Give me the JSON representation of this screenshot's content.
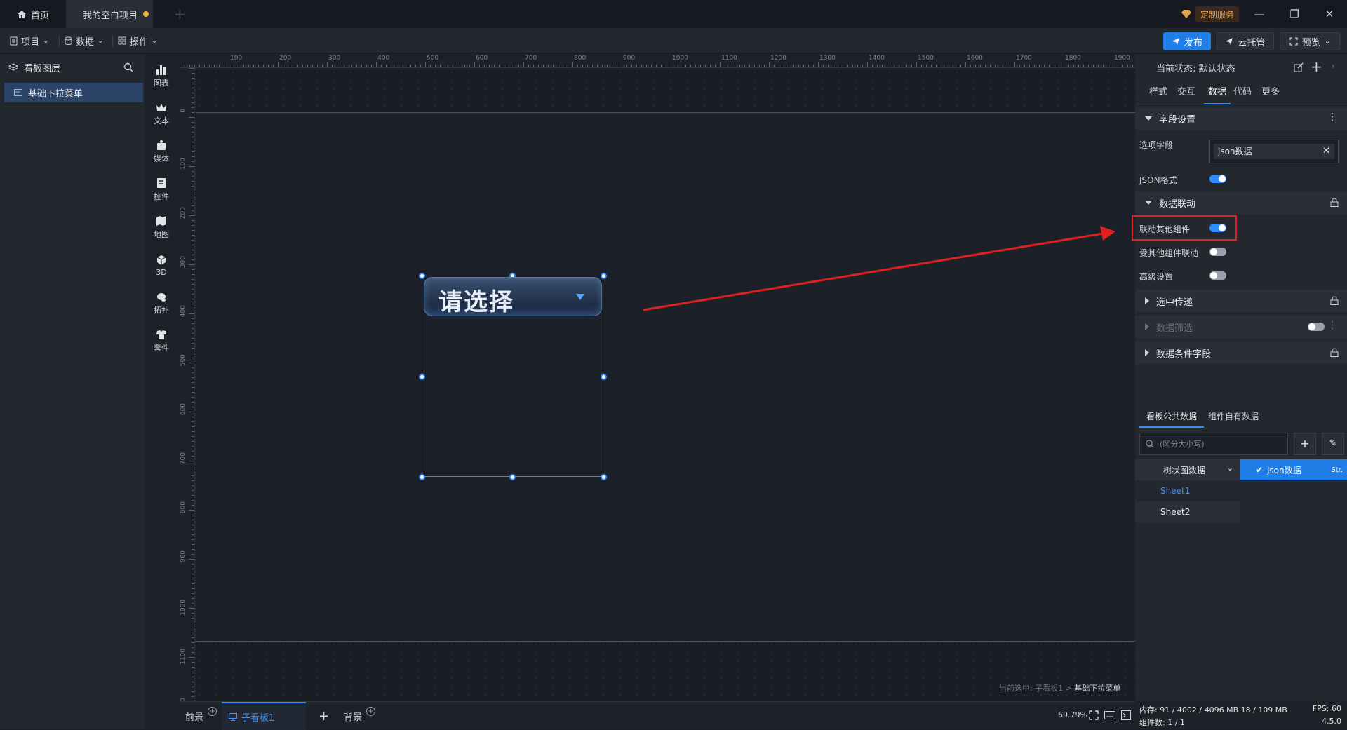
{
  "tabs": {
    "home": "首页",
    "project": "我的空白项目"
  },
  "custom_service": "定制服务",
  "menubar": {
    "project": "项目",
    "data": "数据",
    "operate": "操作",
    "publish": "发布",
    "cloud": "云托管",
    "preview": "预览"
  },
  "layers": {
    "title": "看板图层",
    "items": [
      "基础下拉菜单"
    ]
  },
  "components": [
    "图表",
    "文本",
    "媒体",
    "控件",
    "地图",
    "3D",
    "拓扑",
    "套件"
  ],
  "ruler_top": [
    "100",
    "200",
    "300",
    "400",
    "500",
    "600",
    "700",
    "800",
    "900",
    "1000",
    "1100",
    "1200",
    "1300",
    "1400",
    "1500",
    "1600",
    "1700",
    "1800",
    "1900"
  ],
  "ruler_left": [
    "0",
    "100",
    "200",
    "300",
    "400",
    "500",
    "600",
    "700",
    "800",
    "900",
    "1000",
    "1100",
    "00"
  ],
  "widget": {
    "placeholder": "请选择"
  },
  "canvas_status": {
    "prefix": "当前选中: 子看板1 > ",
    "name": "基础下拉菜单"
  },
  "bottom": {
    "foreground": "前景",
    "sub_board": "子看板1",
    "background": "背景",
    "zoom": "69.79%"
  },
  "sysinfo": {
    "memory": "内存: 91 / 4002 / 4096 MB 18 / 109 MB",
    "fps": "FPS: 60",
    "components": "组件数: 1 / 1",
    "version": "4.5.0"
  },
  "right_panel": {
    "state_label": "当前状态: 默认状态",
    "tabs": [
      "样式",
      "交互",
      "数据",
      "代码",
      "更多"
    ],
    "field_section": "字段设置",
    "option_field_label": "选项字段",
    "option_field_value": "json数据",
    "json_format_label": "JSON格式",
    "linkage_section": "数据联动",
    "link_others_label": "联动其他组件",
    "linked_by_others_label": "受其他组件联动",
    "advanced_label": "高级设置",
    "selected_pass_section": "选中传递",
    "data_filter_section": "数据筛选",
    "condition_field_section": "数据条件字段"
  },
  "data_source": {
    "tabs": [
      "看板公共数据",
      "组件自有数据"
    ],
    "search_placeholder": "(区分大小写)",
    "category": "树状图数据",
    "selected": "json数据",
    "selected_type": "Str.",
    "sheets": [
      "Sheet1",
      "Sheet2"
    ]
  },
  "toggles": {
    "json_format": true,
    "link_others": true,
    "linked_by_others": false,
    "advanced": false,
    "data_filter": false
  },
  "colors": {
    "accent": "#2f8cff",
    "highlight": "#e02020",
    "panel": "#23272e"
  }
}
